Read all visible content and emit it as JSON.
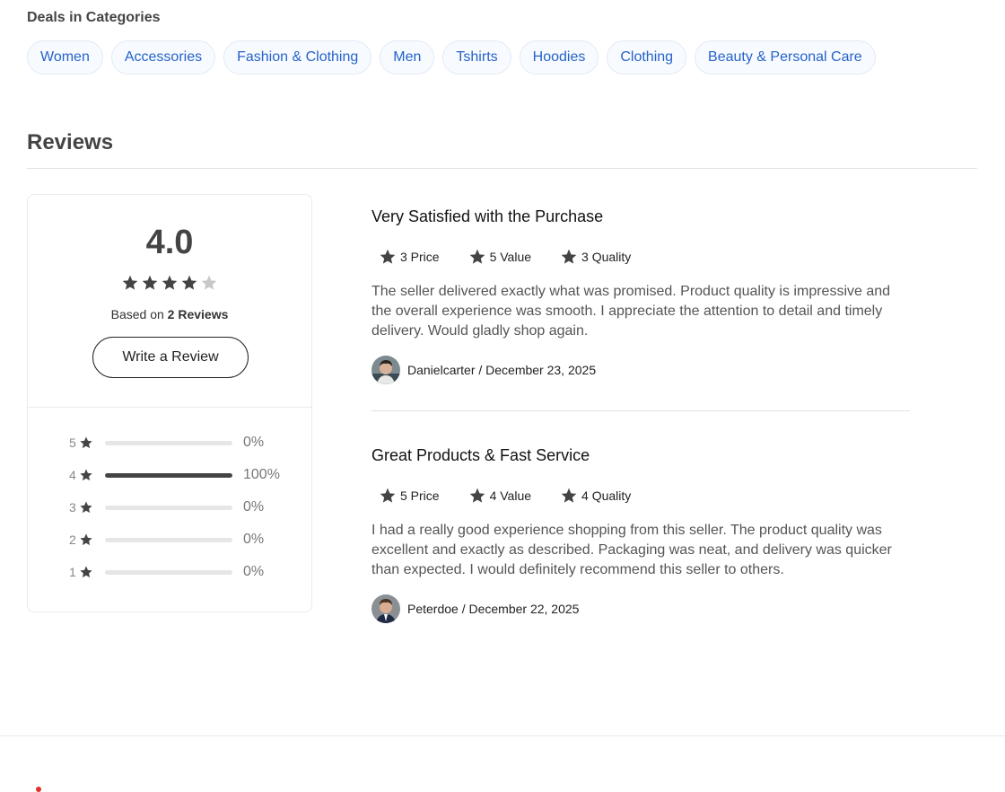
{
  "deals": {
    "title": "Deals in Categories",
    "categories": [
      "Women",
      "Accessories",
      "Fashion & Clothing",
      "Men",
      "Tshirts",
      "Hoodies",
      "Clothing",
      "Beauty & Personal Care"
    ]
  },
  "reviews": {
    "title": "Reviews",
    "summary": {
      "average": "4.0",
      "rating_filled": 4,
      "rating_max": 5,
      "based_on_prefix": "Based on",
      "based_on_count": "2 Reviews",
      "write_review_label": "Write a Review",
      "distribution": [
        {
          "stars": "5",
          "percent": 0,
          "percent_label": "0%"
        },
        {
          "stars": "4",
          "percent": 100,
          "percent_label": "100%"
        },
        {
          "stars": "3",
          "percent": 0,
          "percent_label": "0%"
        },
        {
          "stars": "2",
          "percent": 0,
          "percent_label": "0%"
        },
        {
          "stars": "1",
          "percent": 0,
          "percent_label": "0%"
        }
      ]
    },
    "items": [
      {
        "title": "Very Satisfied with the Purchase",
        "metrics": [
          "3 Price",
          "5 Value",
          "3 Quality"
        ],
        "body": "The seller delivered exactly what was promised. Product quality is impressive and the overall experience was smooth. I appreciate the attention to detail and timely delivery. Would gladly shop again.",
        "author": "Danielcarter / December 23, 2025"
      },
      {
        "title": "Great Products & Fast Service",
        "metrics": [
          "5 Price",
          "4 Value",
          "4 Quality"
        ],
        "body": "I had a really good experience shopping from this seller. The product quality was excellent and exactly as described. Packaging was neat, and delivery was quicker than expected. I would definitely recommend this seller to others.",
        "author": "Peterdoe / December 22, 2025"
      }
    ]
  },
  "colors": {
    "accent_link": "#2563c9",
    "star_filled": "#444444",
    "star_empty": "#c8c8c8",
    "bar_fill": "#444444",
    "bar_track": "#e6e6e6"
  }
}
